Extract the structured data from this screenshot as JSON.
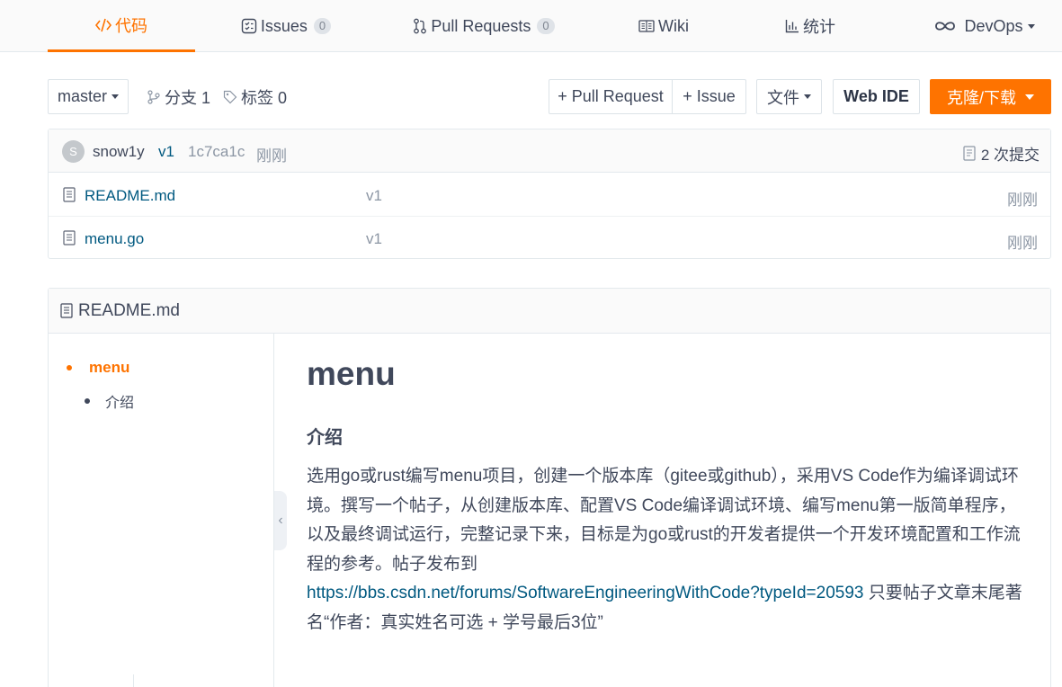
{
  "tabs": [
    {
      "label": "代码",
      "icon": "code-icon",
      "active": true
    },
    {
      "label": "Issues",
      "count": "0",
      "icon": "issues-icon"
    },
    {
      "label": "Pull Requests",
      "count": "0",
      "icon": "pull-request-icon"
    },
    {
      "label": "Wiki",
      "icon": "wiki-icon"
    },
    {
      "label": "统计",
      "icon": "stats-icon"
    },
    {
      "label": "DevOps",
      "icon": "devops-icon"
    }
  ],
  "toolbar": {
    "branch": "master",
    "branches": "分支 1",
    "tags": "标签 0",
    "new_pr": "+ Pull Request",
    "new_issue": "+ Issue",
    "file": "文件",
    "web_ide": "Web IDE",
    "clone": "克隆/下载"
  },
  "commit": {
    "avatar": "S",
    "author": "snow1y",
    "message": "v1",
    "hash": "1c7ca1c",
    "time": "刚刚",
    "count": "2 次提交"
  },
  "files": [
    {
      "name": "README.md",
      "message": "v1",
      "time": "刚刚"
    },
    {
      "name": "menu.go",
      "message": "v1",
      "time": "刚刚"
    }
  ],
  "readme": {
    "filename": "README.md",
    "toc": [
      {
        "label": "menu",
        "active": true
      },
      {
        "label": "介绍"
      }
    ],
    "title": "menu",
    "subtitle": "介绍",
    "paragraph_before": "选用go或rust编写menu项目，创建一个版本库（gitee或github），采用VS Code作为编译调试环境。撰写一个帖子，从创建版本库、配置VS Code编译调试环境、编写menu第一版简单程序，以及最终调试运行，完整记录下来，目标是为go或rust的开发者提供一个开发环境配置和工作流程的参考。帖子发布到",
    "link": "https://bbs.csdn.net/forums/SoftwareEngineeringWithCode?typeId=20593",
    "paragraph_after": " 只要帖子文章末尾著名“作者：真实姓名可选 + 学号最后3位”"
  },
  "colors": {
    "accent": "#fe7300",
    "link": "#005980",
    "text": "#40485b",
    "muted": "#8c96a4"
  }
}
